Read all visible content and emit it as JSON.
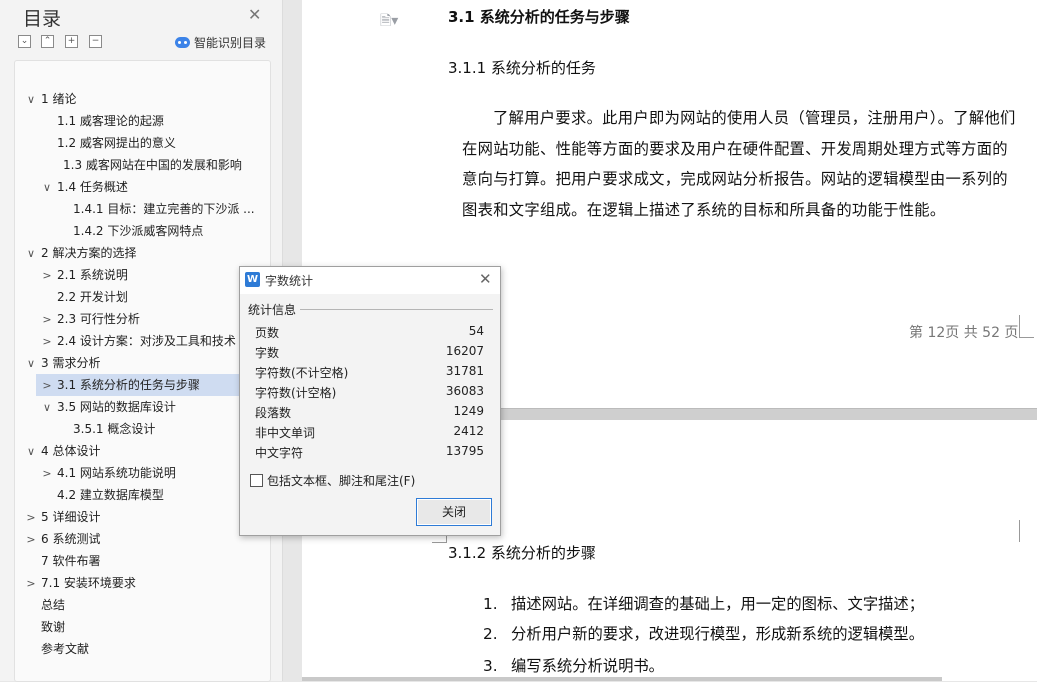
{
  "sidebar": {
    "title": "目录",
    "smart_toc_label": "智能识别目录",
    "toolbar": [
      "collapse-all",
      "expand-level",
      "add-item",
      "remove-item"
    ],
    "items": [
      {
        "label": "1  绪论",
        "level": 0,
        "arrow": "down"
      },
      {
        "label": "1.1  威客理论的起源",
        "level": 2,
        "arrow": ""
      },
      {
        "label": "1.2  威客网提出的意义",
        "level": 2,
        "arrow": ""
      },
      {
        "label": "1.3  威客网站在中国的发展和影响",
        "level": 3,
        "arrow": ""
      },
      {
        "label": "1.4  任务概述",
        "level": 1,
        "arrow": "down"
      },
      {
        "label": "1.4.1  目标：建立完善的下沙派 ...",
        "level": 4,
        "arrow": ""
      },
      {
        "label": "1.4.2  下沙派威客网特点",
        "level": 4,
        "arrow": ""
      },
      {
        "label": "2  解决方案的选择",
        "level": 0,
        "arrow": "down"
      },
      {
        "label": "2.1  系统说明",
        "level": 1,
        "arrow": "right"
      },
      {
        "label": "2.2  开发计划",
        "level": 2,
        "arrow": ""
      },
      {
        "label": "2.3  可行性分析",
        "level": 1,
        "arrow": "right"
      },
      {
        "label": "2.4  设计方案：对涉及工具和技术 ...",
        "level": 1,
        "arrow": "right"
      },
      {
        "label": "3  需求分析",
        "level": 0,
        "arrow": "down"
      },
      {
        "label": "3.1  系统分析的任务与步骤",
        "level": 1,
        "arrow": "right",
        "selected": true
      },
      {
        "label": "3.5  网站的数据库设计",
        "level": 1,
        "arrow": "down"
      },
      {
        "label": "3.5.1  概念设计",
        "level": 4,
        "arrow": ""
      },
      {
        "label": "4  总体设计",
        "level": 0,
        "arrow": "down"
      },
      {
        "label": "4.1  网站系统功能说明",
        "level": 1,
        "arrow": "right"
      },
      {
        "label": "4.2  建立数据库模型",
        "level": 2,
        "arrow": ""
      },
      {
        "label": "5  详细设计",
        "level": 0,
        "arrow": "right"
      },
      {
        "label": "6  系统测试",
        "level": 0,
        "arrow": "right"
      },
      {
        "label": "7  软件布署",
        "level": 5,
        "arrow": ""
      },
      {
        "label": "7.1  安装环境要求",
        "level": 0,
        "arrow": "right"
      },
      {
        "label": "总结",
        "level": 5,
        "arrow": ""
      },
      {
        "label": "致谢",
        "level": 5,
        "arrow": ""
      },
      {
        "label": "参考文献",
        "level": 5,
        "arrow": ""
      }
    ]
  },
  "document": {
    "heading_31": "3.1 系统分析的任务与步骤",
    "heading_311": "3.1.1  系统分析的任务",
    "paragraph": "了解用户要求。此用户即为网站的使用人员（管理员，注册用户）。了解他们在网站功能、性能等方面的要求及用户在硬件配置、开发周期处理方式等方面的意向与打算。把用户要求成文，完成网站分析报告。网站的逻辑模型由一系列的图表和文字组成。在逻辑上描述了系统的目标和所具备的功能于性能。",
    "page_indicator": "第 12页   共 52 页",
    "heading_312": "3.1.2  系统分析的步骤",
    "steps": [
      {
        "num": "1.",
        "text": "描述网站。在详细调查的基础上，用一定的图标、文字描述；"
      },
      {
        "num": "2.",
        "text": "分析用户新的要求，改进现行模型，形成新系统的逻辑模型。"
      },
      {
        "num": "3.",
        "text": "编写系统分析说明书。"
      }
    ]
  },
  "word_count_dialog": {
    "title": "字数统计",
    "section": "统计信息",
    "stats": [
      {
        "label": "页数",
        "value": "54"
      },
      {
        "label": "字数",
        "value": "16207"
      },
      {
        "label": "字符数(不计空格)",
        "value": "31781"
      },
      {
        "label": "字符数(计空格)",
        "value": "36083"
      },
      {
        "label": "段落数",
        "value": "1249"
      },
      {
        "label": "非中文单词",
        "value": "2412"
      },
      {
        "label": "中文字符",
        "value": "13795"
      }
    ],
    "checkbox_label": "包括文本框、脚注和尾注(F)",
    "checkbox_checked": false,
    "close_button": "关闭"
  }
}
